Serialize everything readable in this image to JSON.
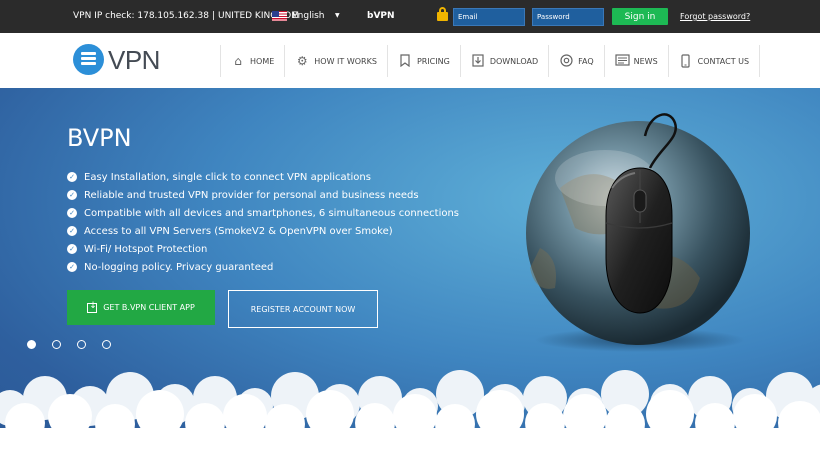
{
  "topbar": {
    "ip_label": "VPN IP check: 178.105.162.38",
    "separator": "|",
    "country": "UNITED KINGDOM",
    "flag_icon": "us-flag-icon",
    "language": "English",
    "language_caret": "▼",
    "brand": "bVPN",
    "email_placeholder": "Email",
    "password_placeholder": "Password",
    "signin_label": "Sign in",
    "forgot_label": "Forgot password?"
  },
  "header": {
    "logo_text": "VPN",
    "nav": [
      {
        "label": "HOME",
        "icon": "home-icon"
      },
      {
        "label": "HOW IT WORKS",
        "icon": "gear-icon"
      },
      {
        "label": "PRICING",
        "icon": "bookmark-icon"
      },
      {
        "label": "DOWNLOAD",
        "icon": "download-icon"
      },
      {
        "label": "FAQ",
        "icon": "help-icon"
      },
      {
        "label": "NEWS",
        "icon": "news-icon"
      },
      {
        "label": "CONTACT US",
        "icon": "phone-icon"
      }
    ]
  },
  "hero": {
    "title": "BVPN",
    "features": [
      "Easy Installation, single click to connect VPN applications",
      "Reliable and trusted VPN provider for personal and business needs",
      "Compatible with all devices and smartphones, 6 simultaneous connections",
      "Access to all VPN Servers (SmokeV2 & OpenVPN over Smoke)",
      "Wi-Fi/ Hotspot Protection",
      "No-logging policy. Privacy guaranteed"
    ],
    "cta_primary": "GET B.VPN CLIENT APP",
    "cta_secondary": "REGISTER ACCOUNT NOW",
    "slide_count": 4,
    "active_slide": 1
  },
  "colors": {
    "topbar_bg": "#2b2b2b",
    "accent_green": "#22a844",
    "hero_blue": "#3f85c0",
    "input_blue": "#1f5f9e",
    "logo_blue": "#2c8fd8",
    "lock_gold": "#f0b400"
  }
}
